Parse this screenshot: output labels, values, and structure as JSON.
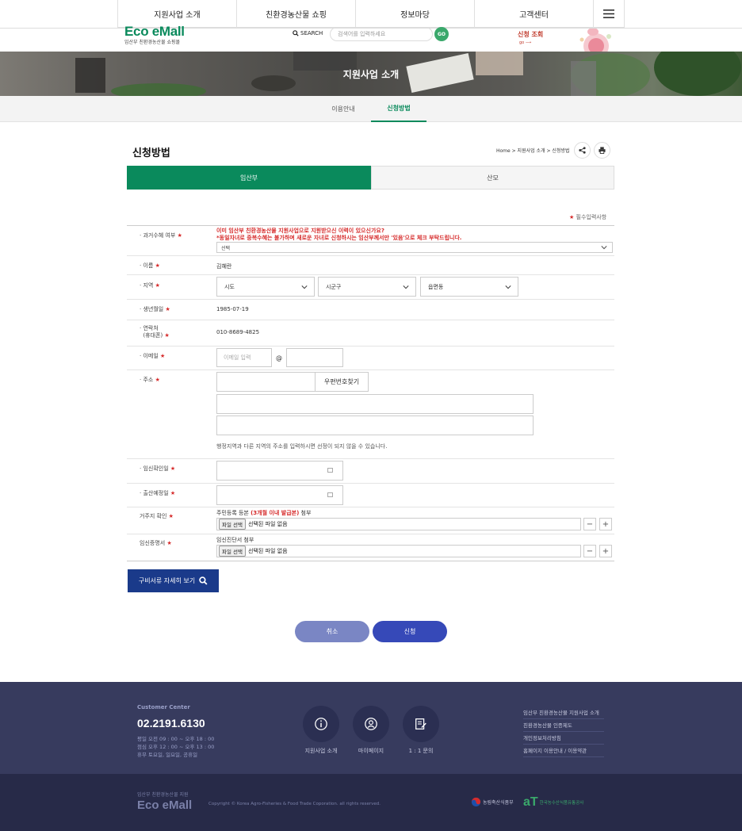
{
  "topnav": {
    "items": [
      "지원사업 소개",
      "친환경농산물 쇼핑",
      "정보마당",
      "고객센터"
    ]
  },
  "header": {
    "logo": "Eco eMall",
    "logo_sub": "임산부 친환경농산물 쇼핑몰",
    "search_label": "SEARCH",
    "search_placeholder": "검색어를 입력하세요",
    "go_label": "GO",
    "promo_title": "신청 조회",
    "promo_go": "go"
  },
  "hero": {
    "title": "지원사업 소개"
  },
  "subtabs": {
    "items": [
      "이용안내",
      "신청방법"
    ],
    "active": "신청방법"
  },
  "page": {
    "title": "신청방법",
    "breadcrumb": "Home > 지원사업 소개 > 신청방법"
  },
  "type_tabs": {
    "items": [
      "임산부",
      "산모"
    ],
    "active": "임산부"
  },
  "form": {
    "required_note": "필수입력사항",
    "past": {
      "label": "· 과거수혜 여부",
      "warn1": "이미 임산부 친환경농산물 지원사업으로 지원받으신 이력이 있으신가요?",
      "warn2": "*동일자녀로 중복수혜는 불가하며 새로운 자녀로 신청하시는 임산부께서만 '있음'으로 체크 부탁드립니다.",
      "select_value": "선택"
    },
    "name": {
      "label": "· 이름",
      "value": "김혜란"
    },
    "region": {
      "label": "· 지역",
      "sido": "시도",
      "sigungu": "시군구",
      "eupmyeon": "읍면동"
    },
    "birth": {
      "label": "· 생년월일",
      "value": "1985-07-19"
    },
    "phone": {
      "label1": "· 연락처",
      "label2": "(휴대폰)",
      "value": "010-8689-4825"
    },
    "email": {
      "label": "· 이메일",
      "placeholder": "이메일 입력",
      "at": "@"
    },
    "address": {
      "label": "· 주소",
      "postcode_button": "우편번호찾기",
      "note": "행정지역과 다른 지역의 주소를 입력하시면 선정이 되지 않을 수 있습니다."
    },
    "pregnancy_date": {
      "label": "· 임신확인일"
    },
    "due_date": {
      "label": "· 출산예정일"
    },
    "residence": {
      "label": "거주지 확인",
      "desc_pre": "주민등록 등본 ",
      "desc_em": "(3개월 이내 발급본)",
      "desc_post": " 첨부",
      "file_button": "파일 선택",
      "file_status": "선택된 파일 없음"
    },
    "certificate": {
      "label": "임신증명서",
      "desc": "임신진단서 첨부",
      "file_button": "파일 선택",
      "file_status": "선택된 파일 없음"
    },
    "minus": "−",
    "plus": "+"
  },
  "buttons": {
    "docs": "구비서류 자세히 보기",
    "cancel": "취소",
    "submit": "신청"
  },
  "footer": {
    "cc_label": "Customer Center",
    "cc_phone": "02.2191.6130",
    "hours": [
      "평일   오전 09 : 00 ~ 오후 18 : 00",
      "점심   오후 12 : 00 ~ 오후 13 : 00",
      "휴무   토요일, 일요일, 공휴일"
    ],
    "icons": [
      "지원사업 소개",
      "마이페이지",
      "1 : 1 문의"
    ],
    "links": [
      "임산부 친환경농산물 지원사업 소개",
      "친환경농산물 인증제도",
      "개인정보처리방침",
      "홈페이지 이용안내 / 이용약관"
    ],
    "bottom_sub": "임산부 친환경농산물 지원",
    "bottom_logo": "Eco eMall",
    "copyright": "Copyright © Korea Agro-Fisheries & Food Trade Coporation. all rights reserved.",
    "org1": "농림축산식품부",
    "org2": "한국농수산식품유통공사"
  },
  "colors": {
    "brand_green": "#0a8a5c",
    "required_red": "#d62b2b",
    "navy": "#1a3a8a",
    "footer": "#373b5e"
  }
}
